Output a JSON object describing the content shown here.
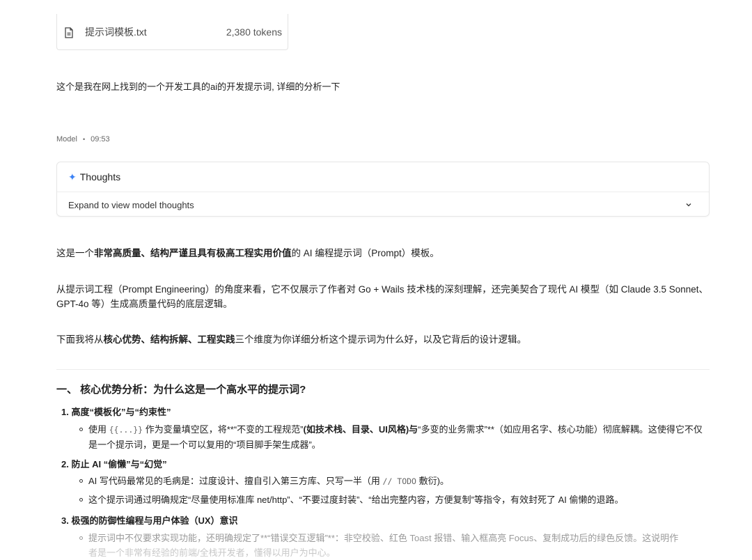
{
  "attachment": {
    "icon": "document-icon",
    "file_name": "提示词模板.txt",
    "tokens": "2,380 tokens"
  },
  "user_message": "这个是我在网上找到的一个开发工具的ai的开发提示词, 详细的分析一下",
  "model_meta": {
    "role": "Model",
    "separator": "•",
    "time": "09:53"
  },
  "thoughts": {
    "title": "Thoughts",
    "expand_label": "Expand to view model thoughts",
    "accent_color": "#3b82f6"
  },
  "response": {
    "p1": {
      "pre": "这是一个",
      "bold": "非常高质量、结构严谨且具有极高工程实用价值",
      "post": "的 AI 编程提示词（Prompt）模板。"
    },
    "p2": "从提示词工程（Prompt Engineering）的角度来看，它不仅展示了作者对 Go + Wails 技术栈的深刻理解，还完美契合了现代 AI 模型（如 Claude 3.5 Sonnet、GPT-4o 等）生成高质量代码的底层逻辑。",
    "p3": {
      "pre": "下面我将从",
      "bold": "核心优势、结构拆解、工程实践",
      "post": "三个维度为你详细分析这个提示词为什么好，以及它背后的设计逻辑。"
    },
    "section_title": "一、 核心优势分析：为什么这是一个高水平的提示词?",
    "items": [
      {
        "title": "1. 高度“模板化”与“约束性”",
        "bullets": [
          {
            "a": "使用 ",
            "code": "{{...}}",
            "b": " 作为变量填空区，将**“不变的工程规范”",
            "bold": "(如技术栈、目录、UI风格)与",
            "c": "“多变的业务需求”**（如应用名字、核心功能）彻底解耦。这使得它不仅是一个提示词，更是一个可以复用的“项目脚手架生成器”。"
          }
        ]
      },
      {
        "title": "2. 防止 AI “偷懒”与“幻觉”",
        "bullets": [
          {
            "a": "AI 写代码最常见的毛病是：过度设计、擅自引入第三方库、只写一半（用 ",
            "code": "// TODO",
            "c": " 敷衍)。"
          },
          {
            "a": "这个提示词通过明确规定“尽量使用标准库 net/http”、“不要过度封装”、“给出完整内容，方便复制”等指令，有效封死了 AI 偷懒的退路。"
          }
        ]
      },
      {
        "title": "3. 极强的防御性编程与用户体验（UX）意识",
        "bullets": [
          {
            "a": "提示词中不仅要求实现功能，还明确规定了**“错误交互逻辑”**：非空校验、红色 Toast 报错、输入框高亮 Focus、复制成功后的绿色反馈。这说明作",
            "c": "者是一个非常有经验的前端/全栈开发者，懂得以用户为中心。"
          }
        ]
      }
    ]
  }
}
